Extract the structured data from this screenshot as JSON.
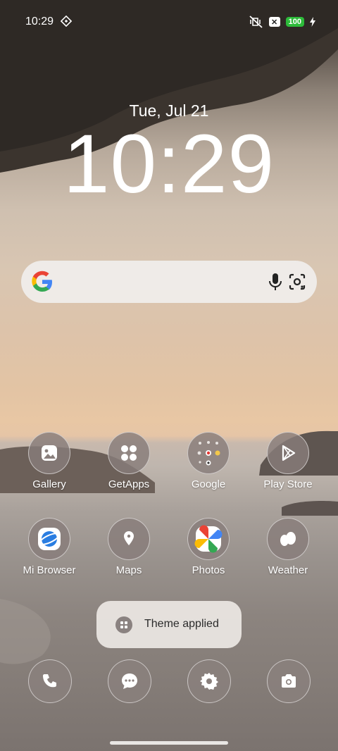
{
  "status_bar": {
    "time": "10:29",
    "battery": "100",
    "icons": [
      "sync-icon",
      "mute-vibrate-icon",
      "x-notification-icon",
      "charging-icon"
    ]
  },
  "lockscreen": {
    "date": "Tue, Jul 21",
    "clock": "10:29"
  },
  "search": {
    "icons": [
      "google-logo",
      "mic-icon",
      "lens-icon"
    ]
  },
  "apps": [
    {
      "label": "Gallery"
    },
    {
      "label": "GetApps"
    },
    {
      "label": "Google"
    },
    {
      "label": "Play Store"
    },
    {
      "label": "Mi Browser"
    },
    {
      "label": "Maps"
    },
    {
      "label": "Photos"
    },
    {
      "label": "Weather"
    }
  ],
  "toast": {
    "text": "Theme applied"
  },
  "dock": [
    "phone-icon",
    "messages-icon",
    "settings-icon",
    "camera-icon"
  ]
}
